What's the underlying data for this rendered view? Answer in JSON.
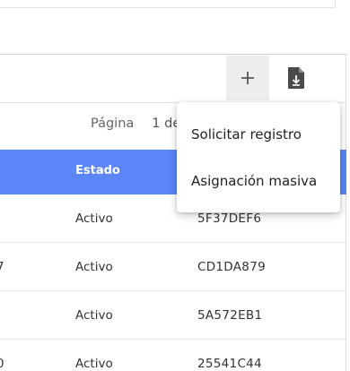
{
  "toolbar": {
    "add_icon": "plus-icon",
    "download_icon": "file-download-icon"
  },
  "pagination": {
    "label": "Página",
    "value": "1 de"
  },
  "table": {
    "header_color": "#5b86f7",
    "columns": {
      "estado": "Estado"
    },
    "rows": [
      {
        "left": "",
        "estado": "Activo",
        "id": "5F37DEF6"
      },
      {
        "left": "7",
        "estado": "Activo",
        "id": "CD1DA879"
      },
      {
        "left": "",
        "estado": "Activo",
        "id": "5A572EB1"
      },
      {
        "left": "0",
        "estado": "Activo",
        "id": "25541C44"
      }
    ]
  },
  "menu": {
    "items": [
      {
        "label": "Solicitar registro"
      },
      {
        "label": "Asignación masiva"
      }
    ]
  }
}
